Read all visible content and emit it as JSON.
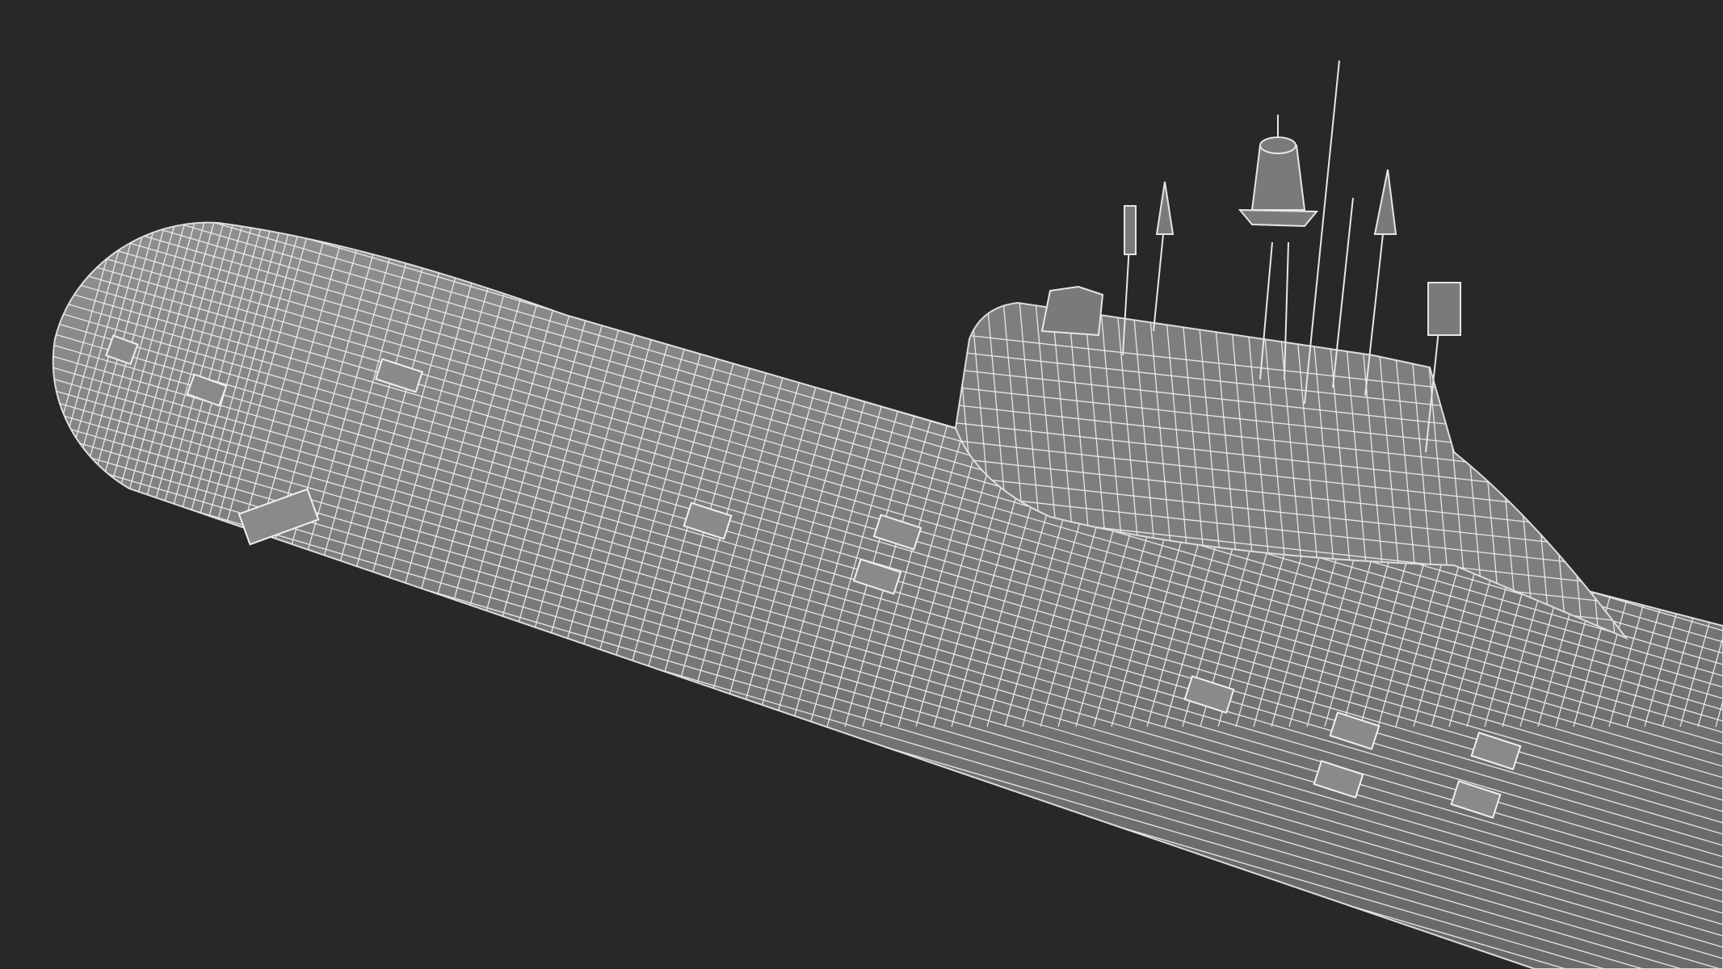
{
  "scene": {
    "background": "#282828",
    "hull_color": "#7b7b7b",
    "wire_color": "#e6e6e6"
  }
}
